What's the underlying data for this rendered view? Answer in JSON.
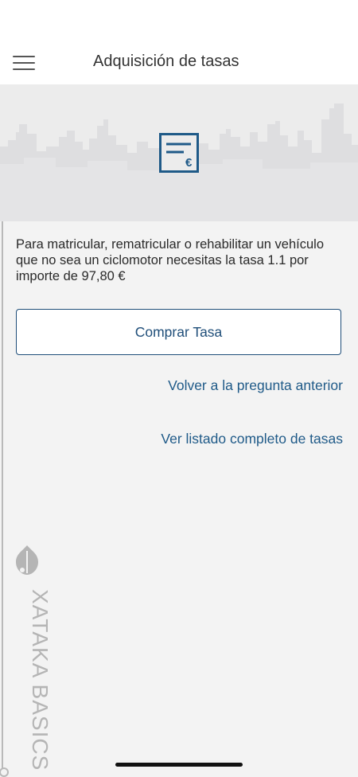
{
  "header": {
    "title": "Adquisición de tasas",
    "menu_icon": "hamburger-menu-icon"
  },
  "hero": {
    "icon": "euro-receipt-icon",
    "icon_symbol": "€",
    "icon_color": "#1f5a88"
  },
  "main": {
    "description": "Para matricular, rematricular o rehabilitar un vehículo que no sea un ciclomotor necesitas la tasa 1.1 por importe de 97,80 €",
    "buy_button_label": "Comprar Tasa",
    "link_previous": "Volver a la pregunta anterior",
    "link_full_list": "Ver listado completo de tasas"
  },
  "watermark": {
    "text": "XATAKA BASICS"
  },
  "colors": {
    "accent": "#1f4e79",
    "link": "#1f5a88",
    "background": "#f3f3f3"
  }
}
